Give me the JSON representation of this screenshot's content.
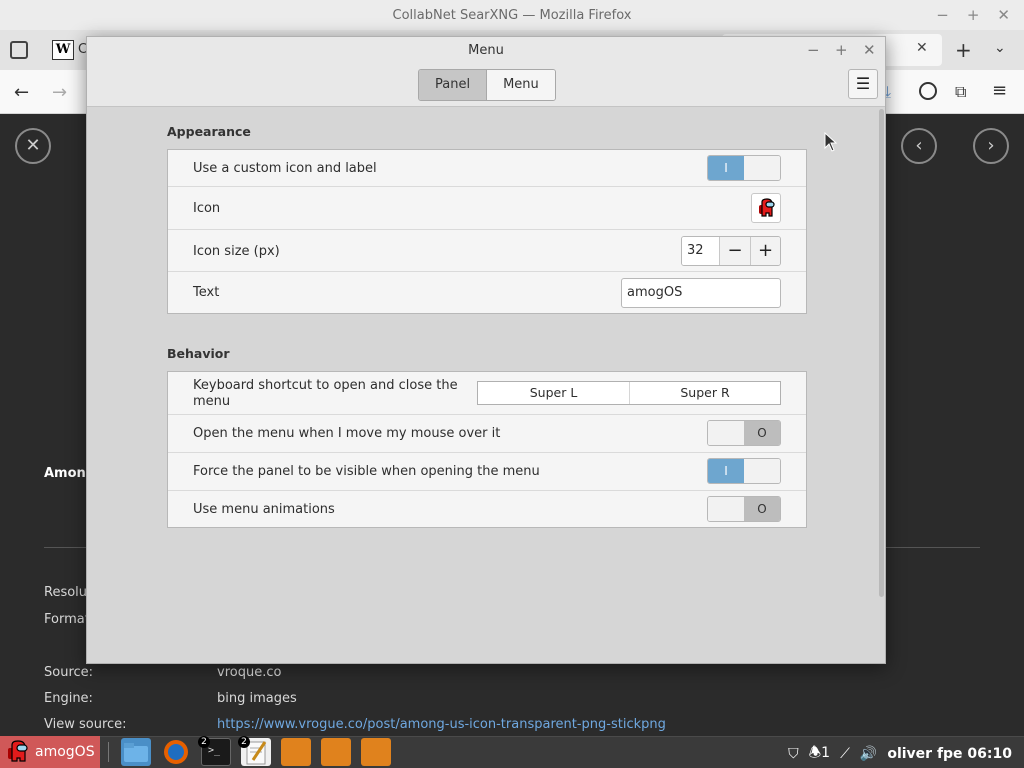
{
  "browser": {
    "title": "CollabNet SearXNG — Mozilla Firefox",
    "tab_title": "C"
  },
  "page": {
    "heading": "Among",
    "resolution_label": "Resolu",
    "format_label": "Format",
    "source_label": "Source:",
    "source_value": "vroque.co",
    "engine_label": "Engine:",
    "engine_value": "bing images",
    "view_source_label": "View source:",
    "view_source_value": "https://www.vrogue.co/post/among-us-icon-transparent-png-stickpng"
  },
  "dialog": {
    "title": "Menu",
    "tabs": [
      {
        "label": "Panel",
        "active": true
      },
      {
        "label": "Menu",
        "active": false
      }
    ],
    "appearance": {
      "title": "Appearance",
      "custom_icon_label": "Use a custom icon and label",
      "custom_icon_on": true,
      "icon_label": "Icon",
      "icon_size_label": "Icon size (px)",
      "icon_size_value": "32",
      "text_label": "Text",
      "text_value": "amogOS"
    },
    "behavior": {
      "title": "Behavior",
      "shortcut_label": "Keyboard shortcut to open and close the menu",
      "shortcut_keys": [
        "Super L",
        "Super R"
      ],
      "hover_label": "Open the menu when I move my mouse over it",
      "hover_on": false,
      "force_panel_label": "Force the panel to be visible when opening the menu",
      "force_panel_on": true,
      "animations_label": "Use menu animations",
      "animations_on": false
    },
    "switch_on_glyph": "I",
    "switch_off_glyph": "O"
  },
  "taskbar": {
    "menu_label": "amogOS",
    "badge_terminal": "2",
    "badge_editor": "2",
    "notifications": "1",
    "clock": "oliver fpe 06:10"
  },
  "colors": {
    "switch_on": "#6ea6cf",
    "menu_applet": "#d05858",
    "link": "#6fa8e0"
  }
}
